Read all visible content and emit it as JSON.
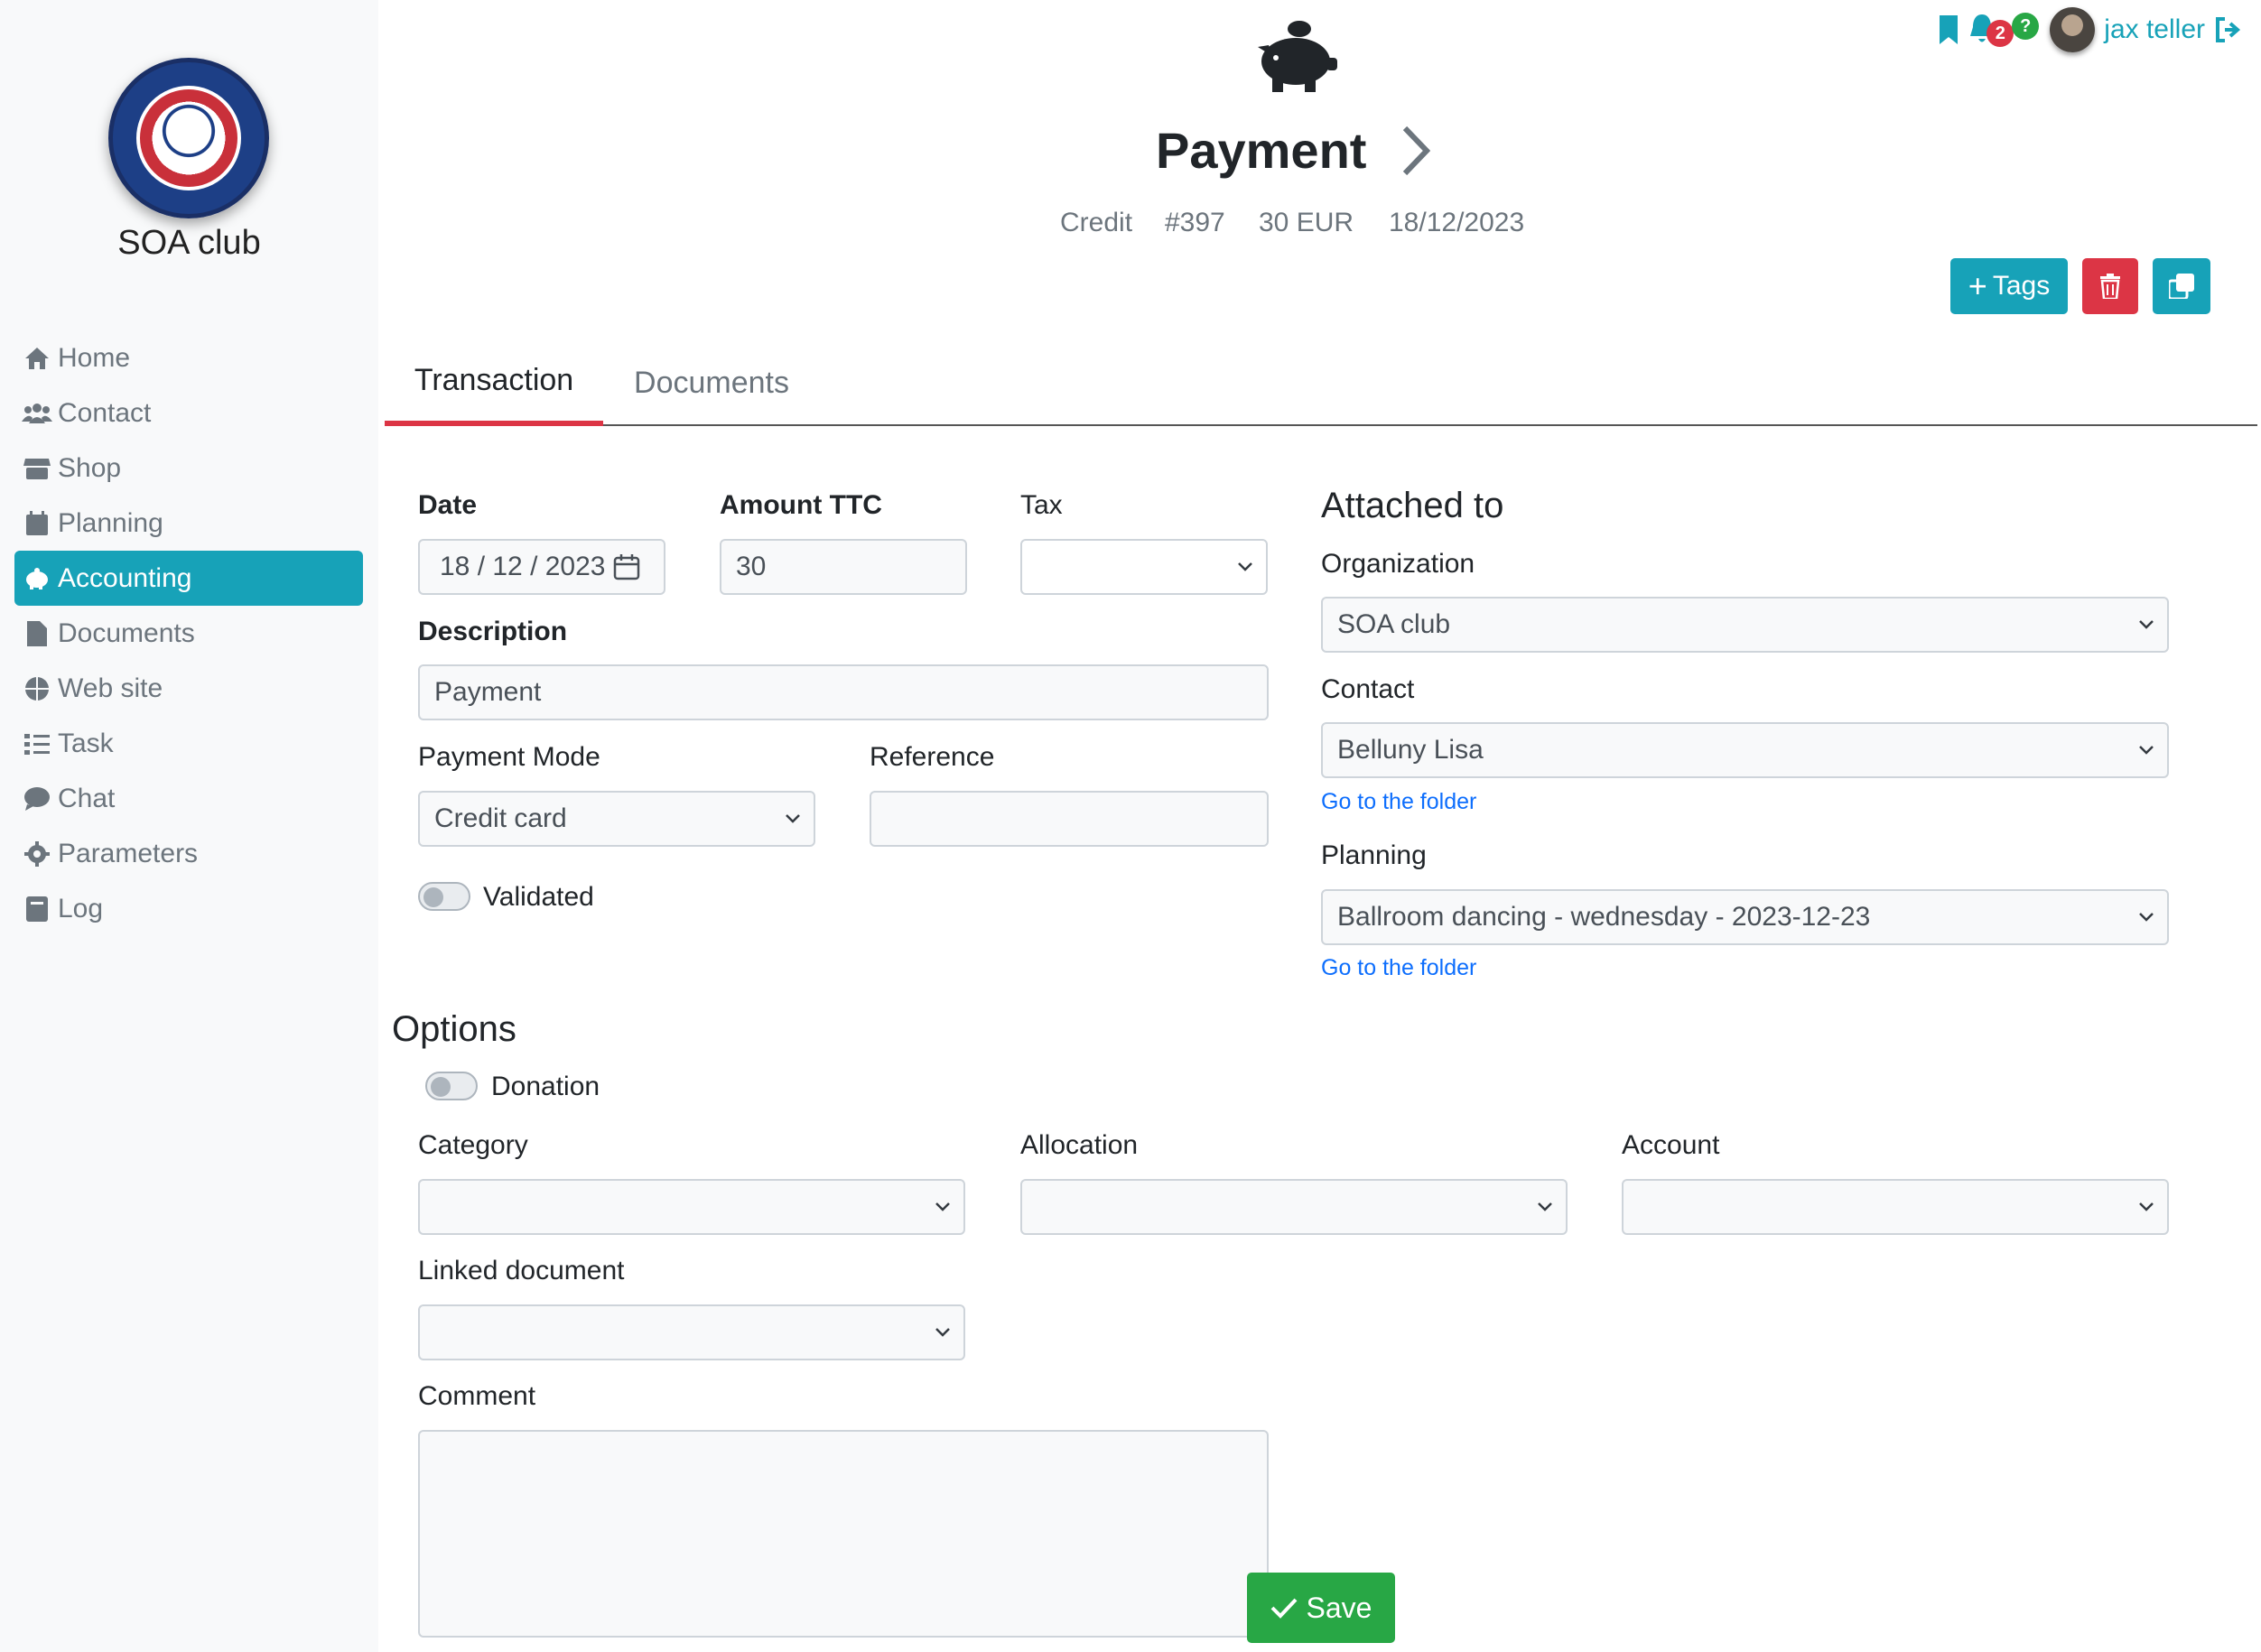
{
  "club": {
    "name": "SOA club"
  },
  "nav": [
    {
      "label": "Home",
      "icon": "home-icon"
    },
    {
      "label": "Contact",
      "icon": "users-icon"
    },
    {
      "label": "Shop",
      "icon": "store-icon"
    },
    {
      "label": "Planning",
      "icon": "calendar-icon"
    },
    {
      "label": "Accounting",
      "icon": "piggy-bank-icon",
      "active": true
    },
    {
      "label": "Documents",
      "icon": "file-icon"
    },
    {
      "label": "Web site",
      "icon": "globe-icon"
    },
    {
      "label": "Task",
      "icon": "tasks-icon"
    },
    {
      "label": "Chat",
      "icon": "chat-icon"
    },
    {
      "label": "Parameters",
      "icon": "gear-icon"
    },
    {
      "label": "Log",
      "icon": "book-icon"
    }
  ],
  "header": {
    "notifications_count": "2",
    "help_badge": "?",
    "username": "jax teller"
  },
  "page": {
    "title": "Payment",
    "type": "Credit",
    "number": "#397",
    "amount": "30 EUR",
    "date": "18/12/2023"
  },
  "actions": {
    "tags_label": "Tags"
  },
  "tabs": [
    {
      "label": "Transaction",
      "active": true
    },
    {
      "label": "Documents"
    }
  ],
  "form": {
    "date_label": "Date",
    "date_value": "18 / 12 / 2023",
    "amount_label": "Amount TTC",
    "amount_value": "30",
    "tax_label": "Tax",
    "tax_value": "",
    "description_label": "Description",
    "description_value": "Payment",
    "payment_mode_label": "Payment Mode",
    "payment_mode_value": "Credit card",
    "reference_label": "Reference",
    "reference_value": "",
    "validated_label": "Validated"
  },
  "attached": {
    "title": "Attached to",
    "organization_label": "Organization",
    "organization_value": "SOA club",
    "contact_label": "Contact",
    "contact_value": "Belluny Lisa",
    "contact_link": "Go to the folder",
    "planning_label": "Planning",
    "planning_value": "Ballroom dancing - wednesday - 2023-12-23",
    "planning_link": "Go to the folder"
  },
  "options": {
    "title": "Options",
    "donation_label": "Donation",
    "category_label": "Category",
    "allocation_label": "Allocation",
    "account_label": "Account",
    "linked_document_label": "Linked document",
    "comment_label": "Comment",
    "save_label": "Save"
  },
  "colors": {
    "accent": "#17a2b8",
    "danger": "#dc3545",
    "success": "#28a745",
    "link": "#0d6efd"
  }
}
